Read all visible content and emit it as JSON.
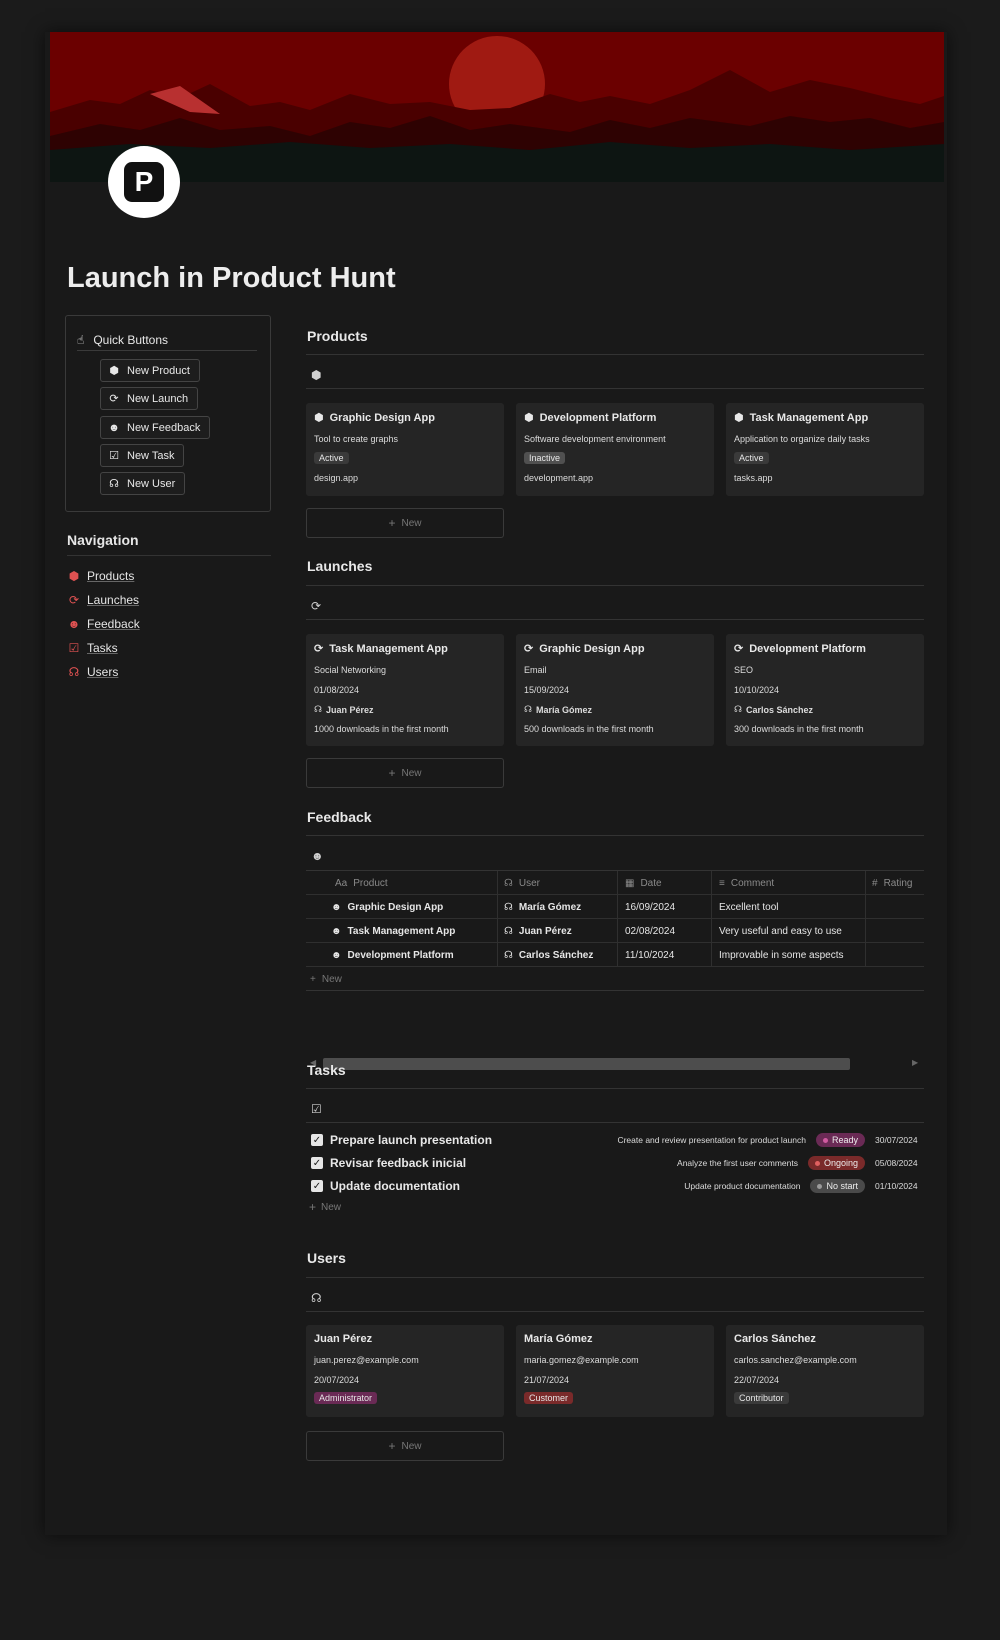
{
  "page": {
    "title": "Launch in Product Hunt",
    "logo_letter": "P"
  },
  "colors": {
    "banner_red": "#6b0000",
    "accent_red": "#e05252",
    "card_bg": "#252525",
    "page_bg": "#191919"
  },
  "quick_buttons": {
    "title": "Quick Buttons",
    "icon": "hand-pointer-icon",
    "items": [
      {
        "label": "New Product",
        "icon": "cube-icon"
      },
      {
        "label": "New Launch",
        "icon": "launch-icon"
      },
      {
        "label": "New Feedback",
        "icon": "smiley-icon"
      },
      {
        "label": "New Task",
        "icon": "checkbox-icon"
      },
      {
        "label": "New User",
        "icon": "headset-icon"
      }
    ]
  },
  "navigation": {
    "title": "Navigation",
    "items": [
      {
        "label": "Products",
        "icon": "cube-icon"
      },
      {
        "label": "Launches",
        "icon": "launch-icon"
      },
      {
        "label": "Feedback",
        "icon": "smiley-icon"
      },
      {
        "label": "Tasks",
        "icon": "checkbox-icon"
      },
      {
        "label": "Users",
        "icon": "headset-icon"
      }
    ]
  },
  "products": {
    "title": "Products",
    "new_label": "New",
    "items": [
      {
        "name": "Graphic Design App",
        "description": "Tool to create graphs",
        "status": "Active",
        "url": "design.app"
      },
      {
        "name": "Development Platform",
        "description": "Software development environment",
        "status": "Inactive",
        "url": "development.app"
      },
      {
        "name": "Task Management App",
        "description": "Application to organize daily tasks",
        "status": "Active",
        "url": "tasks.app"
      }
    ]
  },
  "launches": {
    "title": "Launches",
    "new_label": "New",
    "items": [
      {
        "name": "Task Management App",
        "channel": "Social Networking",
        "date": "01/08/2024",
        "user": "Juan Pérez",
        "goal": "1000 downloads in the first month"
      },
      {
        "name": "Graphic Design App",
        "channel": "Email",
        "date": "15/09/2024",
        "user": "María Gómez",
        "goal": "500 downloads in the first month"
      },
      {
        "name": "Development Platform",
        "channel": "SEO",
        "date": "10/10/2024",
        "user": "Carlos Sánchez",
        "goal": "300 downloads in the first month"
      }
    ]
  },
  "feedback": {
    "title": "Feedback",
    "new_label": "New",
    "columns": [
      "Product",
      "User",
      "Date",
      "Comment",
      "Rating"
    ],
    "column_prefix": {
      "product": "Aa",
      "rating": "#"
    },
    "rows": [
      {
        "product": "Graphic Design App",
        "user": "María Gómez",
        "date": "16/09/2024",
        "comment": "Excellent tool",
        "rating": ""
      },
      {
        "product": "Task Management App",
        "user": "Juan Pérez",
        "date": "02/08/2024",
        "comment": "Very useful and easy to use",
        "rating": ""
      },
      {
        "product": "Development Platform",
        "user": "Carlos Sánchez",
        "date": "11/10/2024",
        "comment": "Improvable in some aspects",
        "rating": ""
      }
    ]
  },
  "tasks": {
    "title": "Tasks",
    "new_label": "New",
    "items": [
      {
        "name": "Prepare launch presentation",
        "description": "Create and review presentation for product launch",
        "status": "Ready",
        "date": "30/07/2024"
      },
      {
        "name": "Revisar feedback inicial",
        "description": "Analyze the first user comments",
        "status": "Ongoing",
        "date": "05/08/2024"
      },
      {
        "name": "Update documentation",
        "description": "Update product documentation",
        "status": "No start",
        "date": "01/10/2024"
      }
    ]
  },
  "users": {
    "title": "Users",
    "new_label": "New",
    "items": [
      {
        "name": "Juan Pérez",
        "email": "juan.perez@example.com",
        "date": "20/07/2024",
        "role": "Administrator"
      },
      {
        "name": "María Gómez",
        "email": "maria.gomez@example.com",
        "date": "21/07/2024",
        "role": "Customer"
      },
      {
        "name": "Carlos Sánchez",
        "email": "carlos.sanchez@example.com",
        "date": "22/07/2024",
        "role": "Contributor"
      }
    ]
  }
}
